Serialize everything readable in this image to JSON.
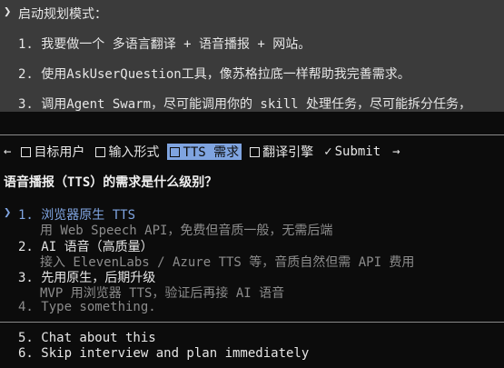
{
  "prompt": {
    "marker": "❯",
    "lines": [
      "启动规划模式：",
      "1. 我要做一个 多语言翻译 + 语音播报 + 网站。",
      "2. 使用AskUserQuestion工具，像苏格拉底一样帮助我完善需求。",
      "3. 调用Agent Swarm，尽可能调用你的 skill 处理任务，尽可能拆分任务，"
    ]
  },
  "tabs": {
    "prev_arrow": "←",
    "next_arrow": "→",
    "items": [
      {
        "label": "目标用户",
        "state": "unchecked"
      },
      {
        "label": "输入形式",
        "state": "unchecked"
      },
      {
        "label": "TTS 需求",
        "state": "active"
      },
      {
        "label": "翻译引擎",
        "state": "unchecked"
      },
      {
        "label": "Submit",
        "state": "checked"
      }
    ],
    "check_mark": "✓"
  },
  "question": "语音播报（TTS）的需求是什么级别？",
  "options": [
    {
      "title": "1. 浏览器原生 TTS",
      "desc": "用 Web Speech API，免费但音质一般，无需后端"
    },
    {
      "title": "2. AI 语音（高质量）",
      "desc": "接入 ElevenLabs / Azure TTS 等，音质自然但需 API 费用"
    },
    {
      "title": "3. 先用原生，后期升级",
      "desc": "MVP 用浏览器 TTS，验证后再接 AI 语音"
    },
    {
      "title": "4. Type something.",
      "desc": ""
    }
  ],
  "pointer": "❯",
  "extra_options": [
    "5. Chat about this",
    "6. Skip interview and plan immediately"
  ],
  "colors": {
    "accent": "#7fa4e0",
    "background": "#0c0c0c",
    "prompt_bg": "#3b3b3b"
  }
}
